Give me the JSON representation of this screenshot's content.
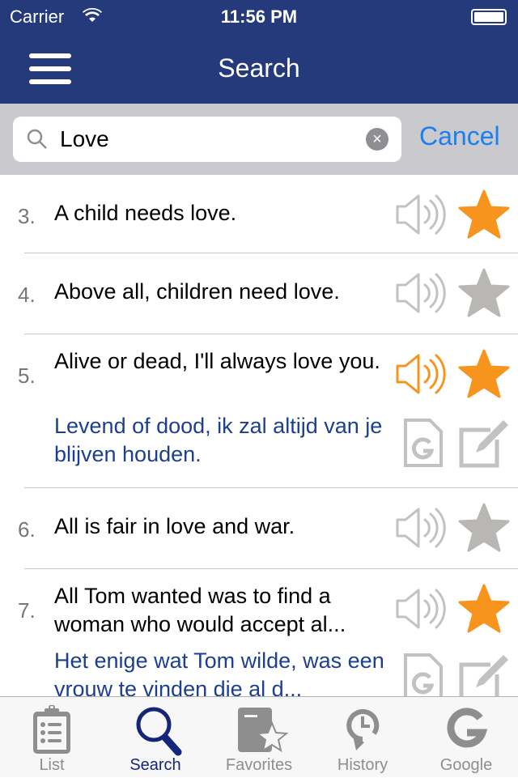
{
  "status": {
    "carrier": "Carrier",
    "time": "11:56 PM"
  },
  "nav": {
    "title": "Search"
  },
  "search": {
    "value": "Love",
    "cancel": "Cancel"
  },
  "colors": {
    "nav": "#253a7a",
    "accent": "#f7941d",
    "translation": "#1d3f8f",
    "tab_active": "#14267a"
  },
  "results": [
    {
      "num": "3.",
      "text": "A child needs love.",
      "favorite": true,
      "playing": false
    },
    {
      "num": "4.",
      "text": "Above all, children need love.",
      "favorite": false,
      "playing": false
    },
    {
      "num": "5.",
      "text": "Alive or dead, I'll always love you.",
      "translation": "Levend of dood, ik zal altijd van je blijven houden.",
      "favorite": true,
      "playing": true
    },
    {
      "num": "6.",
      "text": "All is fair in love and war.",
      "favorite": false,
      "playing": false
    },
    {
      "num": "7.",
      "text": "All Tom wanted was to find a woman who would accept al...",
      "translation": "Het enige wat Tom wilde, was een vrouw te vinden die al d...",
      "favorite": true,
      "playing": false
    }
  ],
  "tabs": [
    {
      "label": "List",
      "icon": "clipboard-list-icon"
    },
    {
      "label": "Search",
      "icon": "magnifier-icon",
      "active": true
    },
    {
      "label": "Favorites",
      "icon": "book-star-icon"
    },
    {
      "label": "History",
      "icon": "clock-history-icon"
    },
    {
      "label": "Google",
      "icon": "google-g-icon"
    }
  ]
}
